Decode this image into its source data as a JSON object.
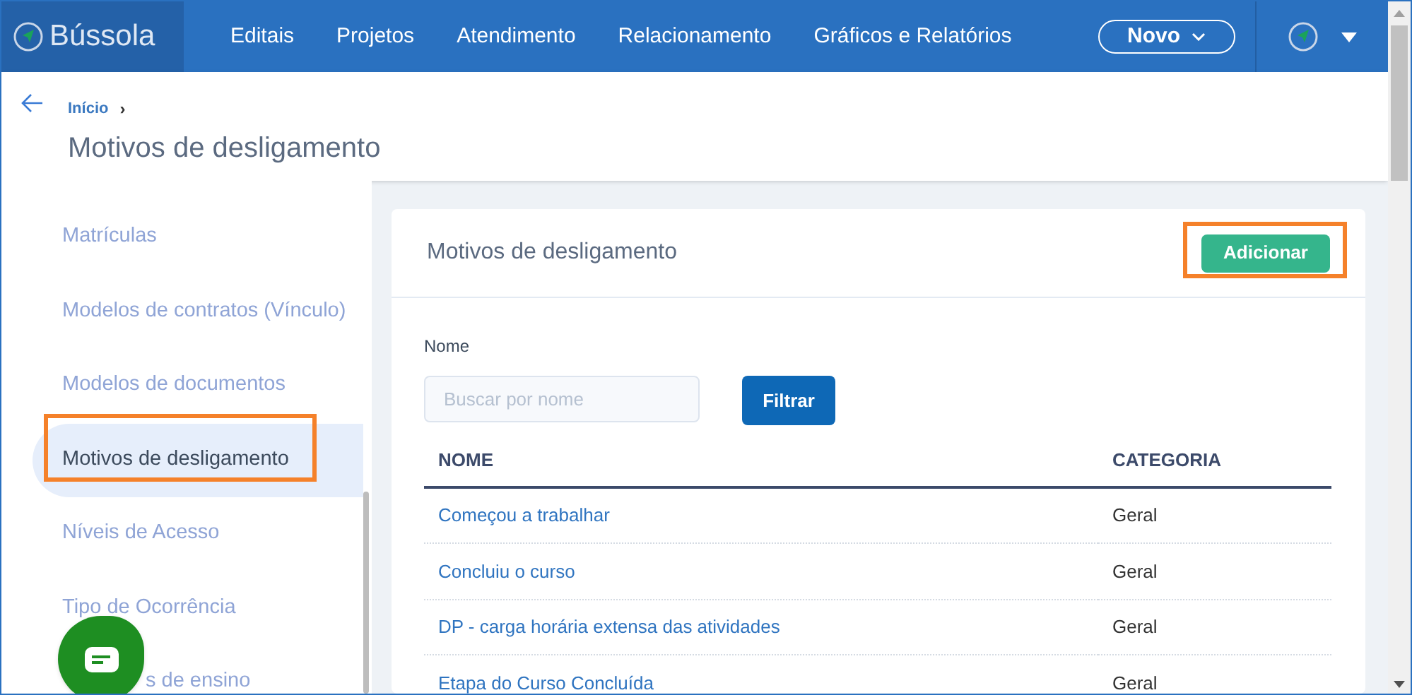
{
  "brand": "Bússola",
  "nav": [
    "Editais",
    "Projetos",
    "Atendimento",
    "Relacionamento",
    "Gráficos e Relatórios"
  ],
  "new_button": "Novo",
  "breadcrumb": "Início",
  "breadcrumb_sep": "›",
  "page_title": "Motivos de desligamento",
  "sidebar": {
    "items": [
      {
        "label": "Matrículas",
        "selected": false,
        "highlighted": false
      },
      {
        "label": "Modelos de contratos (Vínculo)",
        "selected": false,
        "highlighted": false
      },
      {
        "label": "Modelos de documentos",
        "selected": false,
        "highlighted": false
      },
      {
        "label": "Motivos de desligamento",
        "selected": true,
        "highlighted": true
      },
      {
        "label": "Níveis de Acesso",
        "selected": false,
        "highlighted": false
      },
      {
        "label": "Tipo de Ocorrência",
        "selected": false,
        "highlighted": false
      },
      {
        "label": "s de ensino",
        "selected": false,
        "highlighted": false
      }
    ]
  },
  "card": {
    "title": "Motivos de desligamento",
    "add_button": {
      "label": "Adicionar",
      "highlighted": true
    },
    "filter": {
      "label": "Nome",
      "placeholder": "Buscar por nome",
      "button": "Filtrar"
    },
    "table": {
      "columns": [
        "NOME",
        "CATEGORIA"
      ],
      "rows": [
        [
          "Começou a trabalhar",
          "Geral"
        ],
        [
          "Concluiu o curso",
          "Geral"
        ],
        [
          "DP - carga horária extensa das atividades",
          "Geral"
        ],
        [
          "Etapa do Curso Concluída",
          "Geral"
        ]
      ]
    }
  }
}
